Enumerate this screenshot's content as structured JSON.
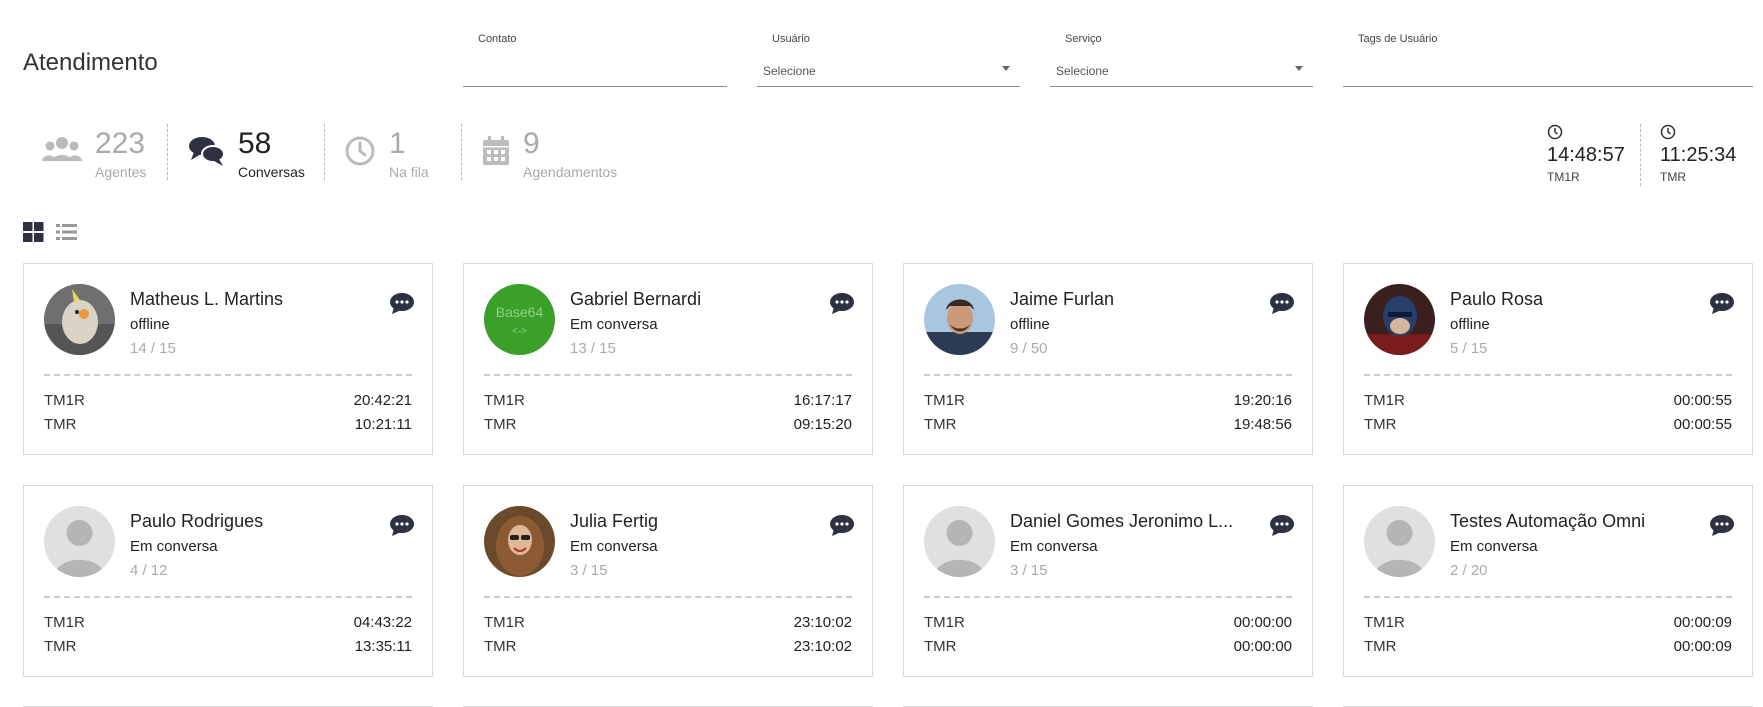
{
  "page": {
    "title": "Atendimento"
  },
  "filters": {
    "contato": {
      "label": "Contato",
      "value": ""
    },
    "usuario": {
      "label": "Usuário",
      "value": "Selecione"
    },
    "servico": {
      "label": "Serviço",
      "value": "Selecione"
    },
    "tags": {
      "label": "Tags de Usuário",
      "value": ""
    }
  },
  "stats": {
    "agentes": {
      "value": "223",
      "label": "Agentes",
      "icon": "users-icon"
    },
    "conversas": {
      "value": "58",
      "label": "Conversas",
      "icon": "comments-icon"
    },
    "fila": {
      "value": "1",
      "label": "Na fila",
      "icon": "clock-icon"
    },
    "agendamentos": {
      "value": "9",
      "label": "Agendamentos",
      "icon": "calendar-icon"
    }
  },
  "times": {
    "tm1r": {
      "value": "14:48:57",
      "label": "TM1R"
    },
    "tmr": {
      "value": "11:25:34",
      "label": "TMR"
    }
  },
  "colors": {
    "accent": "#2d3142",
    "muted": "#aaaaaa",
    "base64_avatar": "#3aa02a"
  },
  "agents": [
    {
      "name": "Matheus L. Martins",
      "status": "offline",
      "count": "14 / 15",
      "tm1r_label": "TM1R",
      "tm1r": "20:42:21",
      "tmr_label": "TMR",
      "tmr": "10:21:11",
      "avatar": "bird-photo"
    },
    {
      "name": "Gabriel Bernardi",
      "status": "Em conversa",
      "count": "13 / 15",
      "tm1r_label": "TM1R",
      "tm1r": "16:17:17",
      "tmr_label": "TMR",
      "tmr": "09:15:20",
      "avatar": "base64-logo",
      "avatar_text": "Base64"
    },
    {
      "name": "Jaime Furlan",
      "status": "offline",
      "count": "9 / 50",
      "tm1r_label": "TM1R",
      "tm1r": "19:20:16",
      "tmr_label": "TMR",
      "tmr": "19:48:56",
      "avatar": "man-photo"
    },
    {
      "name": "Paulo Rosa",
      "status": "offline",
      "count": "5 / 15",
      "tm1r_label": "TM1R",
      "tm1r": "00:00:55",
      "tmr_label": "TMR",
      "tmr": "00:00:55",
      "avatar": "hero-photo"
    },
    {
      "name": "Paulo Rodrigues",
      "status": "Em conversa",
      "count": "4 / 12",
      "tm1r_label": "TM1R",
      "tm1r": "04:43:22",
      "tmr_label": "TMR",
      "tmr": "13:35:11",
      "avatar": "default"
    },
    {
      "name": "Julia Fertig",
      "status": "Em conversa",
      "count": "3 / 15",
      "tm1r_label": "TM1R",
      "tm1r": "23:10:02",
      "tmr_label": "TMR",
      "tmr": "23:10:02",
      "avatar": "woman-photo"
    },
    {
      "name": "Daniel Gomes Jeronimo L...",
      "status": "Em conversa",
      "count": "3 / 15",
      "tm1r_label": "TM1R",
      "tm1r": "00:00:00",
      "tmr_label": "TMR",
      "tmr": "00:00:00",
      "avatar": "default"
    },
    {
      "name": "Testes Automação Omni",
      "status": "Em conversa",
      "count": "2 / 20",
      "tm1r_label": "TM1R",
      "tm1r": "00:00:09",
      "tmr_label": "TMR",
      "tmr": "00:00:09",
      "avatar": "default"
    }
  ]
}
